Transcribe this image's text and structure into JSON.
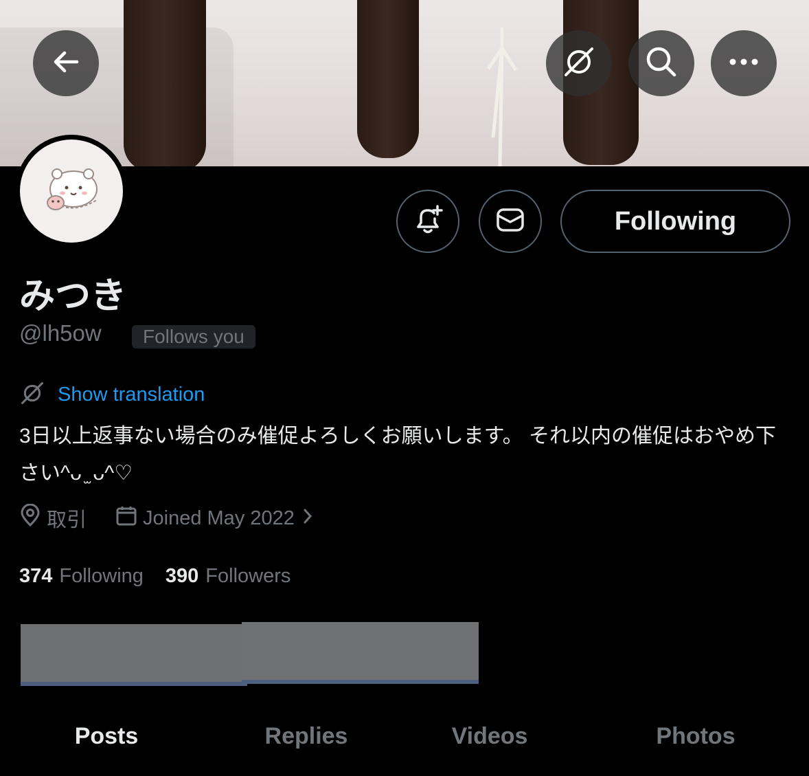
{
  "profile": {
    "display_name": "みつき",
    "handle": "@lh5ow",
    "follows_you": "Follows you",
    "show_translation": "Show translation",
    "bio": "3日以上返事ない場合のみ催促よろしくお願いします。 それ以内の催促はおやめ下さい^ᴗ ̫ ᴗ^♡",
    "location": "取引",
    "joined": "Joined May 2022",
    "following_count": "374",
    "following_label": "Following",
    "followers_count": "390",
    "followers_label": "Followers"
  },
  "actions": {
    "following_button": "Following"
  },
  "header_icons": [
    "back-arrow-icon",
    "grok-icon",
    "search-icon",
    "more-icon"
  ],
  "tabs": [
    {
      "label": "Posts",
      "active": true
    },
    {
      "label": "Replies",
      "active": false
    },
    {
      "label": "Videos",
      "active": false
    },
    {
      "label": "Photos",
      "active": false
    }
  ],
  "colors": {
    "background": "#000000",
    "accent_link": "#1d9bf0",
    "muted_text": "#71767b",
    "primary_text": "#e7e9ea",
    "border": "#536471"
  }
}
